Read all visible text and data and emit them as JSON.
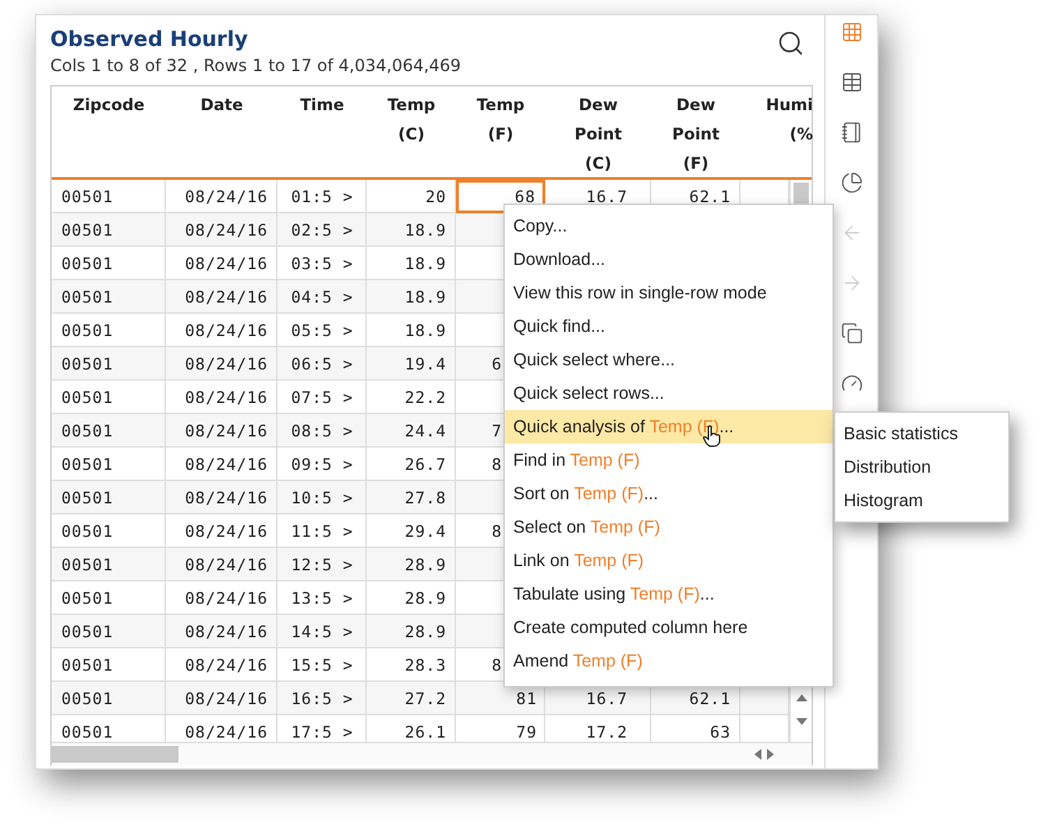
{
  "title": "Observed Hourly",
  "subtitle": "Cols 1 to 8 of 32 , Rows 1 to 17 of 4,034,064,469",
  "columns": [
    {
      "lines": [
        "Zipcode"
      ]
    },
    {
      "lines": [
        "Date"
      ]
    },
    {
      "lines": [
        "Time"
      ]
    },
    {
      "lines": [
        "Temp",
        "(C)"
      ]
    },
    {
      "lines": [
        "Temp",
        "(F)"
      ]
    },
    {
      "lines": [
        "Dew",
        "Point",
        "(C)"
      ]
    },
    {
      "lines": [
        "Dew",
        "Point",
        "(F)"
      ]
    },
    {
      "lines": [
        "Humi",
        "(%"
      ]
    }
  ],
  "rows": [
    {
      "zipcode": "00501",
      "date": "08/24/16",
      "time": "01:5 >",
      "temp_c": "20",
      "temp_f": "68",
      "temp_f_cut": false,
      "temp_f_selected": true,
      "dew_c": "16.7",
      "dew_f": "62.1"
    },
    {
      "zipcode": "00501",
      "date": "08/24/16",
      "time": "02:5 >",
      "temp_c": "18.9",
      "temp_f_selected": false
    },
    {
      "zipcode": "00501",
      "date": "08/24/16",
      "time": "03:5 >",
      "temp_c": "18.9",
      "temp_f_selected": false
    },
    {
      "zipcode": "00501",
      "date": "08/24/16",
      "time": "04:5 >",
      "temp_c": "18.9",
      "temp_f_selected": false
    },
    {
      "zipcode": "00501",
      "date": "08/24/16",
      "time": "05:5 >",
      "temp_c": "18.9",
      "temp_f_selected": false
    },
    {
      "zipcode": "00501",
      "date": "08/24/16",
      "time": "06:5 >",
      "temp_c": "19.4",
      "temp_f": "6",
      "temp_f_cut": true,
      "temp_f_selected": false
    },
    {
      "zipcode": "00501",
      "date": "08/24/16",
      "time": "07:5 >",
      "temp_c": "22.2",
      "temp_f_selected": false
    },
    {
      "zipcode": "00501",
      "date": "08/24/16",
      "time": "08:5 >",
      "temp_c": "24.4",
      "temp_f": "7",
      "temp_f_cut": true,
      "temp_f_selected": false
    },
    {
      "zipcode": "00501",
      "date": "08/24/16",
      "time": "09:5 >",
      "temp_c": "26.7",
      "temp_f": "8",
      "temp_f_cut": true,
      "temp_f_selected": false
    },
    {
      "zipcode": "00501",
      "date": "08/24/16",
      "time": "10:5 >",
      "temp_c": "27.8",
      "temp_f_selected": false
    },
    {
      "zipcode": "00501",
      "date": "08/24/16",
      "time": "11:5 >",
      "temp_c": "29.4",
      "temp_f": "8",
      "temp_f_cut": true,
      "temp_f_selected": false
    },
    {
      "zipcode": "00501",
      "date": "08/24/16",
      "time": "12:5 >",
      "temp_c": "28.9",
      "temp_f_selected": false
    },
    {
      "zipcode": "00501",
      "date": "08/24/16",
      "time": "13:5 >",
      "temp_c": "28.9",
      "temp_f_selected": false
    },
    {
      "zipcode": "00501",
      "date": "08/24/16",
      "time": "14:5 >",
      "temp_c": "28.9",
      "temp_f_selected": false
    },
    {
      "zipcode": "00501",
      "date": "08/24/16",
      "time": "15:5 >",
      "temp_c": "28.3",
      "temp_f": "8",
      "temp_f_cut": true,
      "temp_f_selected": false
    },
    {
      "zipcode": "00501",
      "date": "08/24/16",
      "time": "16:5 >",
      "temp_c": "27.2",
      "temp_f": "81",
      "temp_f_cut": false,
      "temp_f_selected": false,
      "dew_c": "16.7",
      "dew_f": "62.1"
    },
    {
      "zipcode": "00501",
      "date": "08/24/16",
      "time": "17:5 >",
      "temp_c": "26.1",
      "temp_f": "79",
      "temp_f_cut": false,
      "temp_f_selected": false,
      "dew_c": "17.2",
      "dew_f": "63"
    }
  ],
  "menu": [
    {
      "parts": [
        {
          "text": "Copy...",
          "highlight": false
        }
      ],
      "selected": false
    },
    {
      "parts": [
        {
          "text": "Download...",
          "highlight": false
        }
      ],
      "selected": false
    },
    {
      "parts": [
        {
          "text": "View this row in single-row mode",
          "highlight": false
        }
      ],
      "selected": false
    },
    {
      "parts": [
        {
          "text": "Quick find...",
          "highlight": false
        }
      ],
      "selected": false
    },
    {
      "parts": [
        {
          "text": "Quick select where...",
          "highlight": false
        }
      ],
      "selected": false
    },
    {
      "parts": [
        {
          "text": "Quick select rows...",
          "highlight": false
        }
      ],
      "selected": false
    },
    {
      "parts": [
        {
          "text": "Quick analysis of ",
          "highlight": false
        },
        {
          "text": "Temp (F)",
          "highlight": true
        },
        {
          "text": "...",
          "highlight": false
        }
      ],
      "selected": true
    },
    {
      "parts": [
        {
          "text": "Find in ",
          "highlight": false
        },
        {
          "text": "Temp (F)",
          "highlight": true
        }
      ],
      "selected": false
    },
    {
      "parts": [
        {
          "text": "Sort on ",
          "highlight": false
        },
        {
          "text": "Temp (F)",
          "highlight": true
        },
        {
          "text": "...",
          "highlight": false
        }
      ],
      "selected": false
    },
    {
      "parts": [
        {
          "text": "Select on ",
          "highlight": false
        },
        {
          "text": "Temp (F)",
          "highlight": true
        }
      ],
      "selected": false
    },
    {
      "parts": [
        {
          "text": "Link on ",
          "highlight": false
        },
        {
          "text": "Temp (F)",
          "highlight": true
        }
      ],
      "selected": false
    },
    {
      "parts": [
        {
          "text": "Tabulate using ",
          "highlight": false
        },
        {
          "text": "Temp (F)",
          "highlight": true
        },
        {
          "text": "...",
          "highlight": false
        }
      ],
      "selected": false
    },
    {
      "parts": [
        {
          "text": "Create computed column here",
          "highlight": false
        }
      ],
      "selected": false
    },
    {
      "parts": [
        {
          "text": "Amend ",
          "highlight": false
        },
        {
          "text": "Temp (F)",
          "highlight": true
        }
      ],
      "selected": false
    }
  ],
  "submenu": [
    "Basic statistics",
    "Distribution",
    "Histogram"
  ],
  "sidebar": [
    {
      "kind": "grid",
      "selected": true,
      "disabled": false
    },
    {
      "kind": "table",
      "selected": false,
      "disabled": false
    },
    {
      "kind": "book",
      "selected": false,
      "disabled": false
    },
    {
      "kind": "pie",
      "selected": false,
      "disabled": false
    },
    {
      "kind": "back",
      "selected": false,
      "disabled": true
    },
    {
      "kind": "forward",
      "selected": false,
      "disabled": true
    },
    {
      "kind": "copy",
      "selected": false,
      "disabled": false
    },
    {
      "kind": "gauge",
      "selected": false,
      "disabled": false
    }
  ]
}
